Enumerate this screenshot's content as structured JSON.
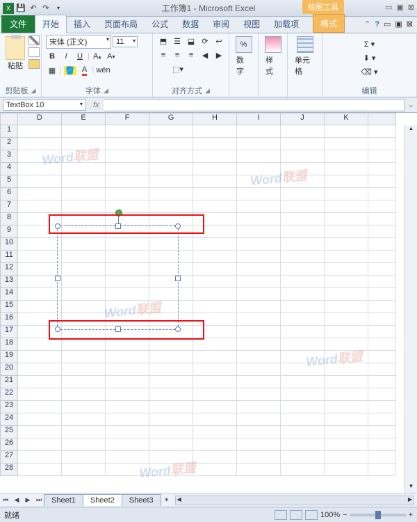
{
  "title": "工作簿1 - Microsoft Excel",
  "drawing_tools": "绘图工具",
  "tabs": {
    "file": "文件",
    "home": "开始",
    "insert": "插入",
    "layout": "页面布局",
    "formula": "公式",
    "data": "数据",
    "review": "审阅",
    "view": "视图",
    "addin": "加载项",
    "format": "格式"
  },
  "ribbon": {
    "clipboard": {
      "paste": "粘贴",
      "label": "剪贴板"
    },
    "font": {
      "name": "宋体 (正文)",
      "size": "11",
      "label": "字体"
    },
    "align": {
      "label": "对齐方式"
    },
    "number": {
      "btn": "数字"
    },
    "style": {
      "btn": "样式"
    },
    "cells": {
      "btn": "单元格"
    },
    "editing": {
      "label": "编辑"
    }
  },
  "namebox": "TextBox 10",
  "fx": "fx",
  "cols": [
    "D",
    "E",
    "F",
    "G",
    "H",
    "I",
    "J",
    "K"
  ],
  "rows": [
    "1",
    "2",
    "3",
    "4",
    "5",
    "6",
    "7",
    "8",
    "9",
    "10",
    "11",
    "12",
    "13",
    "14",
    "15",
    "16",
    "17",
    "18",
    "19",
    "20",
    "21",
    "22",
    "23",
    "24",
    "25",
    "26",
    "27",
    "28"
  ],
  "sheets": {
    "s1": "Sheet1",
    "s2": "Sheet2",
    "s3": "Sheet3"
  },
  "status": "就绪",
  "zoom": "100%",
  "watermark": {
    "w": "Word",
    "r": "联盟"
  }
}
